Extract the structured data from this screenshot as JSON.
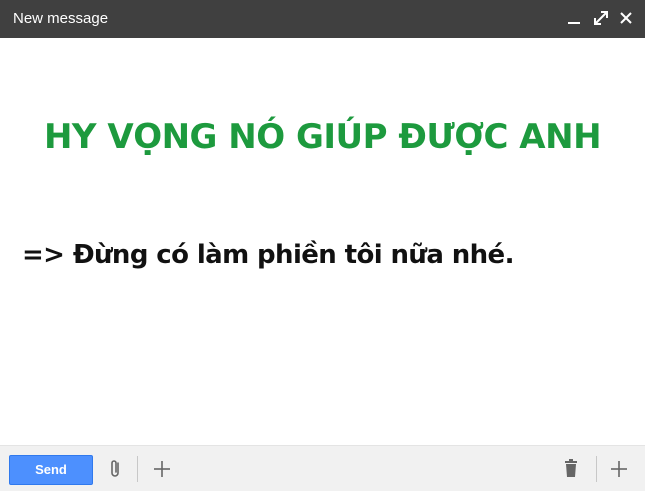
{
  "window": {
    "title": "New message",
    "controls": {
      "minimize_icon": "minimize-icon",
      "expand_icon": "expand-icon",
      "close_icon": "close-icon"
    }
  },
  "message": {
    "headline": "HY VỌNG NÓ GIÚP ĐƯỢC ANH",
    "line": "=> Đừng có làm phiền tôi nữa nhé."
  },
  "footer": {
    "send_label": "Send",
    "icons": {
      "attach": "paperclip-icon",
      "more_left": "plus-icon",
      "trash": "trash-icon",
      "more_right": "plus-icon"
    }
  },
  "colors": {
    "titlebar": "#404040",
    "headline": "#1d9a3e",
    "send_button": "#4d90fe",
    "footer": "#f1f1f1"
  }
}
